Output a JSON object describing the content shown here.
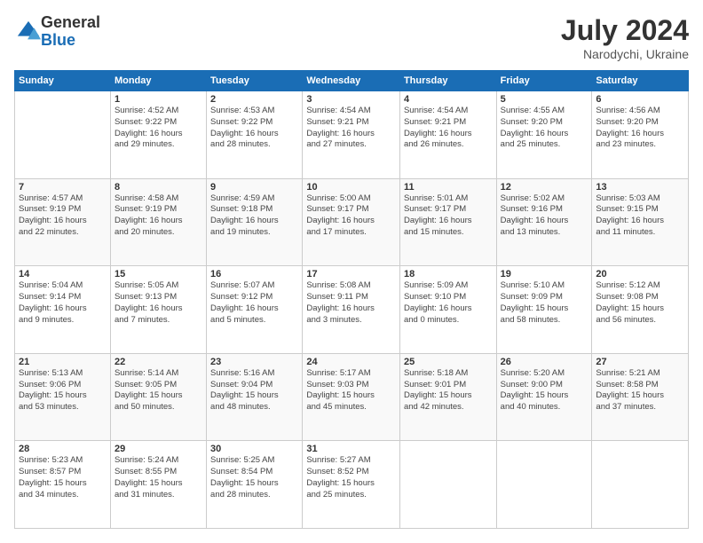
{
  "logo": {
    "general": "General",
    "blue": "Blue"
  },
  "title": {
    "month_year": "July 2024",
    "location": "Narodychi, Ukraine"
  },
  "days_of_week": [
    "Sunday",
    "Monday",
    "Tuesday",
    "Wednesday",
    "Thursday",
    "Friday",
    "Saturday"
  ],
  "weeks": [
    [
      {
        "day": "",
        "info": ""
      },
      {
        "day": "1",
        "info": "Sunrise: 4:52 AM\nSunset: 9:22 PM\nDaylight: 16 hours\nand 29 minutes."
      },
      {
        "day": "2",
        "info": "Sunrise: 4:53 AM\nSunset: 9:22 PM\nDaylight: 16 hours\nand 28 minutes."
      },
      {
        "day": "3",
        "info": "Sunrise: 4:54 AM\nSunset: 9:21 PM\nDaylight: 16 hours\nand 27 minutes."
      },
      {
        "day": "4",
        "info": "Sunrise: 4:54 AM\nSunset: 9:21 PM\nDaylight: 16 hours\nand 26 minutes."
      },
      {
        "day": "5",
        "info": "Sunrise: 4:55 AM\nSunset: 9:20 PM\nDaylight: 16 hours\nand 25 minutes."
      },
      {
        "day": "6",
        "info": "Sunrise: 4:56 AM\nSunset: 9:20 PM\nDaylight: 16 hours\nand 23 minutes."
      }
    ],
    [
      {
        "day": "7",
        "info": "Sunrise: 4:57 AM\nSunset: 9:19 PM\nDaylight: 16 hours\nand 22 minutes."
      },
      {
        "day": "8",
        "info": "Sunrise: 4:58 AM\nSunset: 9:19 PM\nDaylight: 16 hours\nand 20 minutes."
      },
      {
        "day": "9",
        "info": "Sunrise: 4:59 AM\nSunset: 9:18 PM\nDaylight: 16 hours\nand 19 minutes."
      },
      {
        "day": "10",
        "info": "Sunrise: 5:00 AM\nSunset: 9:17 PM\nDaylight: 16 hours\nand 17 minutes."
      },
      {
        "day": "11",
        "info": "Sunrise: 5:01 AM\nSunset: 9:17 PM\nDaylight: 16 hours\nand 15 minutes."
      },
      {
        "day": "12",
        "info": "Sunrise: 5:02 AM\nSunset: 9:16 PM\nDaylight: 16 hours\nand 13 minutes."
      },
      {
        "day": "13",
        "info": "Sunrise: 5:03 AM\nSunset: 9:15 PM\nDaylight: 16 hours\nand 11 minutes."
      }
    ],
    [
      {
        "day": "14",
        "info": "Sunrise: 5:04 AM\nSunset: 9:14 PM\nDaylight: 16 hours\nand 9 minutes."
      },
      {
        "day": "15",
        "info": "Sunrise: 5:05 AM\nSunset: 9:13 PM\nDaylight: 16 hours\nand 7 minutes."
      },
      {
        "day": "16",
        "info": "Sunrise: 5:07 AM\nSunset: 9:12 PM\nDaylight: 16 hours\nand 5 minutes."
      },
      {
        "day": "17",
        "info": "Sunrise: 5:08 AM\nSunset: 9:11 PM\nDaylight: 16 hours\nand 3 minutes."
      },
      {
        "day": "18",
        "info": "Sunrise: 5:09 AM\nSunset: 9:10 PM\nDaylight: 16 hours\nand 0 minutes."
      },
      {
        "day": "19",
        "info": "Sunrise: 5:10 AM\nSunset: 9:09 PM\nDaylight: 15 hours\nand 58 minutes."
      },
      {
        "day": "20",
        "info": "Sunrise: 5:12 AM\nSunset: 9:08 PM\nDaylight: 15 hours\nand 56 minutes."
      }
    ],
    [
      {
        "day": "21",
        "info": "Sunrise: 5:13 AM\nSunset: 9:06 PM\nDaylight: 15 hours\nand 53 minutes."
      },
      {
        "day": "22",
        "info": "Sunrise: 5:14 AM\nSunset: 9:05 PM\nDaylight: 15 hours\nand 50 minutes."
      },
      {
        "day": "23",
        "info": "Sunrise: 5:16 AM\nSunset: 9:04 PM\nDaylight: 15 hours\nand 48 minutes."
      },
      {
        "day": "24",
        "info": "Sunrise: 5:17 AM\nSunset: 9:03 PM\nDaylight: 15 hours\nand 45 minutes."
      },
      {
        "day": "25",
        "info": "Sunrise: 5:18 AM\nSunset: 9:01 PM\nDaylight: 15 hours\nand 42 minutes."
      },
      {
        "day": "26",
        "info": "Sunrise: 5:20 AM\nSunset: 9:00 PM\nDaylight: 15 hours\nand 40 minutes."
      },
      {
        "day": "27",
        "info": "Sunrise: 5:21 AM\nSunset: 8:58 PM\nDaylight: 15 hours\nand 37 minutes."
      }
    ],
    [
      {
        "day": "28",
        "info": "Sunrise: 5:23 AM\nSunset: 8:57 PM\nDaylight: 15 hours\nand 34 minutes."
      },
      {
        "day": "29",
        "info": "Sunrise: 5:24 AM\nSunset: 8:55 PM\nDaylight: 15 hours\nand 31 minutes."
      },
      {
        "day": "30",
        "info": "Sunrise: 5:25 AM\nSunset: 8:54 PM\nDaylight: 15 hours\nand 28 minutes."
      },
      {
        "day": "31",
        "info": "Sunrise: 5:27 AM\nSunset: 8:52 PM\nDaylight: 15 hours\nand 25 minutes."
      },
      {
        "day": "",
        "info": ""
      },
      {
        "day": "",
        "info": ""
      },
      {
        "day": "",
        "info": ""
      }
    ]
  ]
}
